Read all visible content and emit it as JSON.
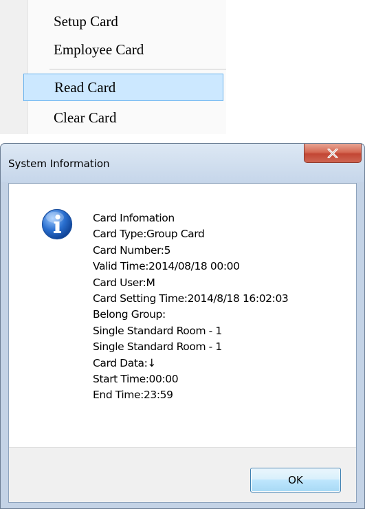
{
  "context_menu": {
    "items": [
      {
        "label": "Setup Card",
        "highlighted": false
      },
      {
        "label": "Employee Card",
        "highlighted": false
      },
      {
        "label": "Read Card",
        "highlighted": true
      },
      {
        "label": "Clear Card",
        "highlighted": false
      }
    ]
  },
  "dialog": {
    "title": "System Information",
    "close_label": "X",
    "icon": "info-icon",
    "message_lines": [
      "Card Infomation",
      "Card Type:Group Card",
      "Card Number:5",
      "Valid Time:2014/08/18 00:00",
      "Card User:M",
      "Card Setting Time:2014/8/18 16:02:03",
      "Belong Group:",
      "Single Standard Room - 1",
      "Single Standard Room - 1",
      "Card Data:↓",
      "Start Time:00:00",
      "End Time:23:59"
    ],
    "ok_label": "OK"
  },
  "colors": {
    "highlight_fill": "#cce8ff",
    "highlight_border": "#64b0ee",
    "close_button": "#c24634",
    "info_icon": "#2a6fcf"
  }
}
